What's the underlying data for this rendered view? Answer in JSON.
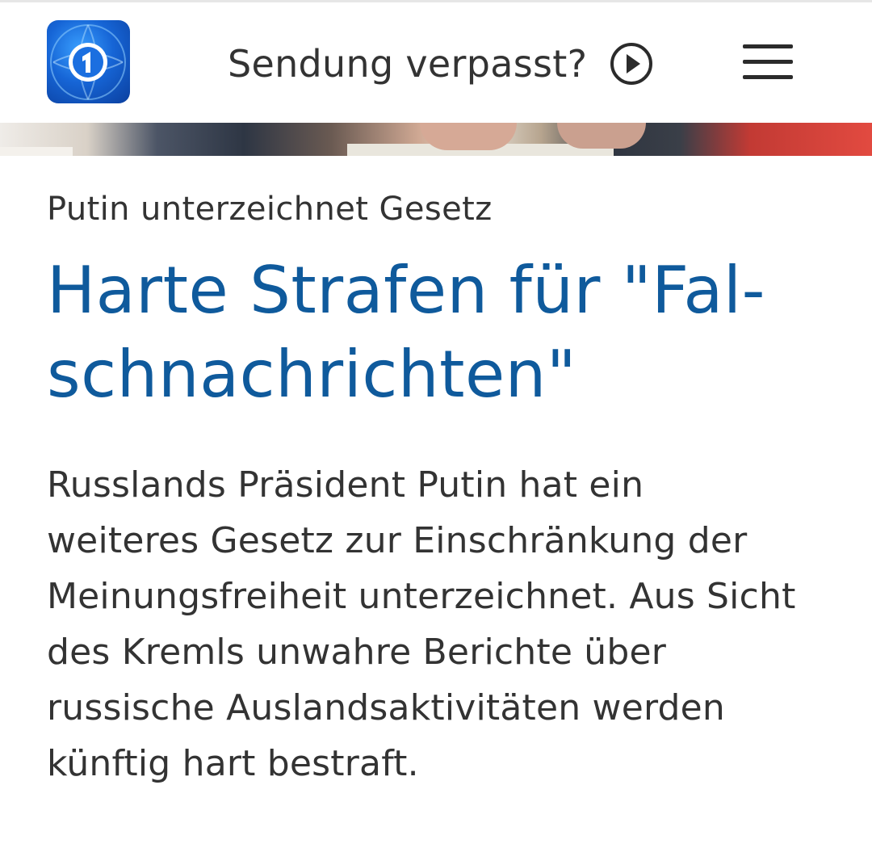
{
  "header": {
    "logo_name": "tagesschau-logo",
    "missed_show_label": "Sendung verpasst?",
    "play_icon": "play-circle-icon",
    "menu_icon": "hamburger-menu-icon"
  },
  "article": {
    "topline": "Putin unterzeichnet Gesetz",
    "headline_lines": [
      "Harte Strafen für \"Fal-",
      "schnachrichten\""
    ],
    "teaser_lines": [
      "Russlands Präsident Putin hat ein",
      "weiteres Gesetz zur Einschränkung der",
      "Meinungsfreiheit unterzeichnet. Aus Sicht",
      "des Kremls unwahre Berichte über",
      "russische Auslandsaktivitäten werden",
      "künftig hart bestraft."
    ]
  },
  "colors": {
    "headline": "#0f5a9c",
    "text": "#333333",
    "logo_blue": "#1665d6"
  }
}
